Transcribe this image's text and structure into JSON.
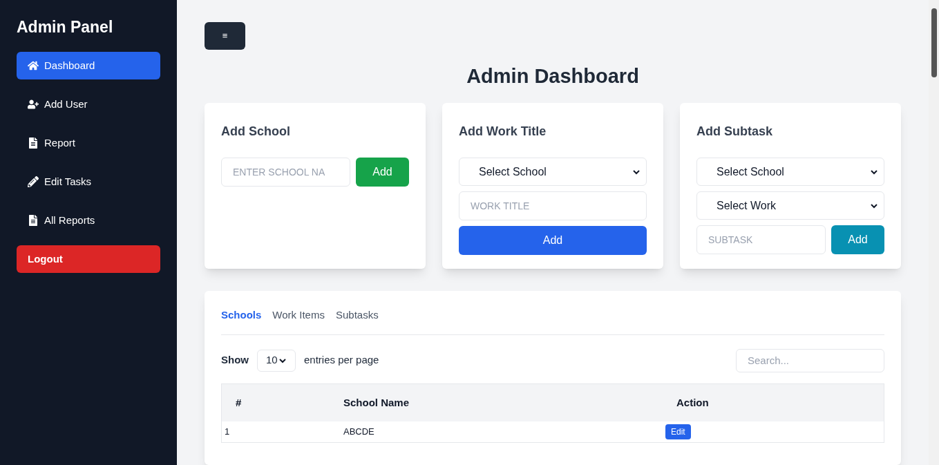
{
  "sidebar": {
    "title": "Admin Panel",
    "items": [
      {
        "label": "Dashboard",
        "selected": true
      },
      {
        "label": "Add User",
        "selected": false
      },
      {
        "label": "Report",
        "selected": false
      },
      {
        "label": "Edit Tasks",
        "selected": false
      },
      {
        "label": "All Reports",
        "selected": false
      }
    ],
    "logout": "Logout"
  },
  "menu_button": "≡",
  "title": "Admin Dashboard",
  "cards": [
    {
      "title": "Add School",
      "fields": [
        {
          "kind": "input",
          "placeholder": "ENTER SCHOOL NA",
          "button": "Add"
        }
      ]
    },
    {
      "title": "Add Work Title",
      "fields": [
        {
          "kind": "select",
          "value": "Select School"
        },
        {
          "kind": "input",
          "placeholder": "WORK TITLE"
        },
        {
          "kind": "button",
          "button": "Add"
        }
      ]
    },
    {
      "title": "Add Subtask",
      "fields": [
        {
          "kind": "select",
          "value": "Select School"
        },
        {
          "kind": "select",
          "value": "Select Work"
        },
        {
          "kind": "input",
          "placeholder": "SUBTASK",
          "button": "Add"
        }
      ]
    }
  ],
  "list": {
    "tabs": [
      {
        "label": "Schools",
        "selected": true
      },
      {
        "label": "Work Items",
        "selected": false
      },
      {
        "label": "Subtasks",
        "selected": false
      }
    ],
    "show": "Show",
    "entries_value": "10",
    "entries_label": "entries per page",
    "search_placeholder": "Search...",
    "columns": [
      "#",
      "School Name",
      "Action"
    ],
    "rows": [
      {
        "number": "1",
        "name": "ABCDE",
        "action": "Edit"
      }
    ]
  }
}
